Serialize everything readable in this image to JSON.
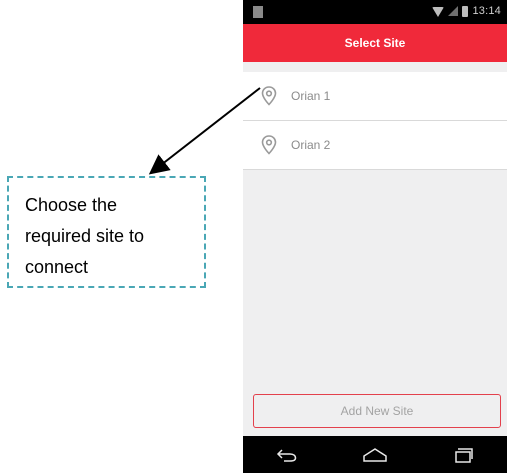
{
  "status_bar": {
    "time": "13:14"
  },
  "app": {
    "title": "Select Site",
    "accent_color": "#f0293a"
  },
  "sites": [
    {
      "label": "Orian 1",
      "icon": "location-pin-icon"
    },
    {
      "label": "Orian 2",
      "icon": "location-pin-icon"
    }
  ],
  "actions": {
    "add_new_site": "Add New Site"
  },
  "nav": {
    "back_icon": "back-icon",
    "home_icon": "home-icon",
    "recents_icon": "recents-icon"
  },
  "annotation": {
    "lines": [
      "Choose the",
      "required site to",
      "connect"
    ],
    "border_color": "#4aa7b5"
  }
}
